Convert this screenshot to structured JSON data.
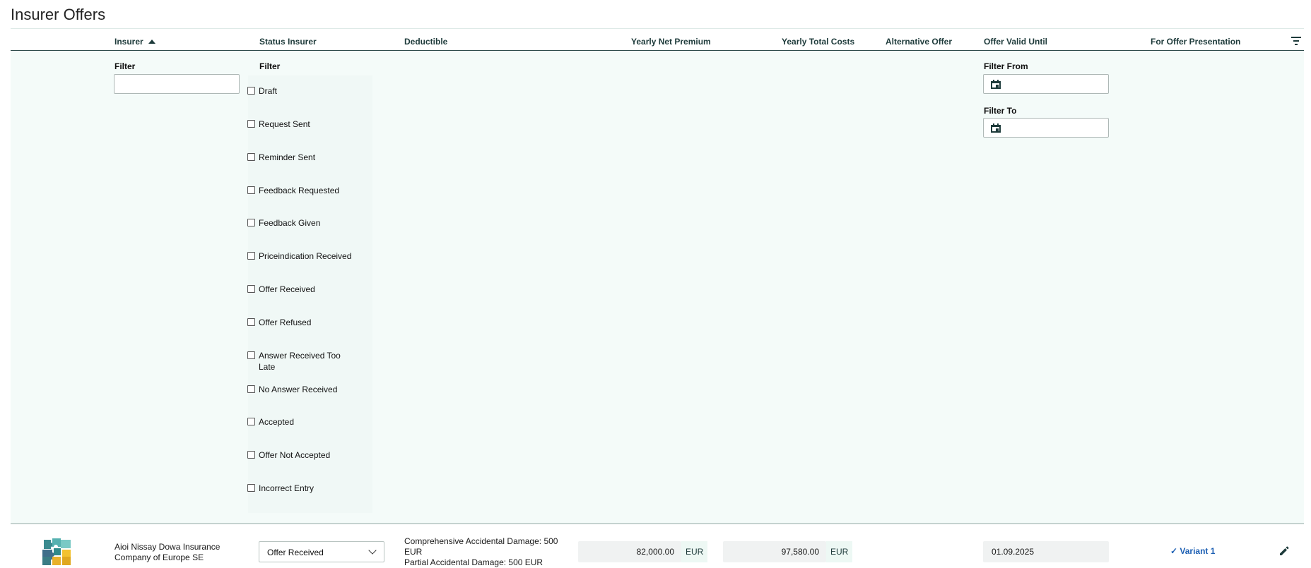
{
  "page": {
    "title": "Insurer Offers"
  },
  "table": {
    "columns": {
      "insurer": "Insurer",
      "status": "Status Insurer",
      "deductible": "Deductible",
      "net_premium": "Yearly Net Premium",
      "total_costs": "Yearly Total Costs",
      "alternative": "Alternative Offer",
      "valid_until": "Offer Valid Until",
      "presentation": "For Offer Presentation"
    },
    "sort": {
      "column": "insurer",
      "direction": "ascending"
    }
  },
  "filters": {
    "insurer_label": "Filter",
    "insurer_value": "",
    "status_label": "Filter",
    "status_options": [
      "Draft",
      "Request Sent",
      "Reminder Sent",
      "Feedback Requested",
      "Feedback Given",
      "Priceindication Received",
      "Offer Received",
      "Offer Refused",
      "Answer Received Too Late",
      "No Answer Received",
      "Accepted",
      "Offer Not Accepted",
      "Incorrect Entry"
    ],
    "date_from_label": "Filter From",
    "date_from_value": "",
    "date_to_label": "Filter To",
    "date_to_value": ""
  },
  "rows": [
    {
      "insurer_name": "Aioi Nissay Dowa Insurance Company of Europe SE",
      "status": "Offer Received",
      "deductible_line1": "Comprehensive Accidental Damage: 500",
      "deductible_line2": "EUR",
      "deductible_line3": "Partial Accidental Damage: 500 EUR",
      "net_premium": "82,000.00",
      "net_premium_currency": "EUR",
      "total_costs": "97,580.00",
      "total_costs_currency": "EUR",
      "valid_until": "01.09.2025",
      "presentation": "✓ Variant 1"
    }
  ],
  "icons": {
    "sort": "sort-ascending-icon",
    "filter_menu": "filter-list-icon",
    "calendar": "calendar-icon",
    "dropdown": "chevron-down-icon",
    "edit": "pencil-icon",
    "logo": "insurer-puzzle-logo"
  },
  "colors": {
    "accent_dark": "#1d3a3a",
    "filter_bg": "#f4fbf9",
    "link": "#1c5fb3"
  }
}
